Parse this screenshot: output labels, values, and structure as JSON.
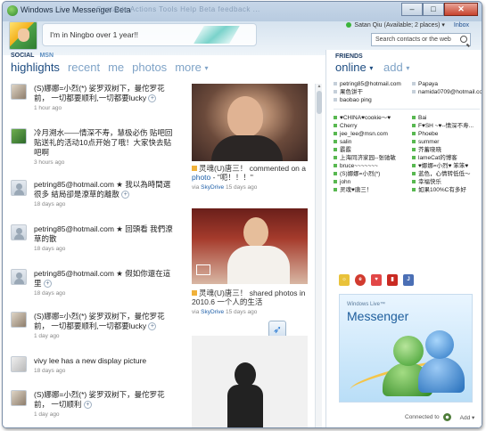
{
  "window": {
    "title": "Windows Live Messenger Beta",
    "faded_menu": "Contacts   Actions   Tools   Help   Beta feedback   ...",
    "minimize": "–",
    "maximize": "□",
    "close": "✕"
  },
  "header": {
    "status_message": "I'm in Ningbo over 1 year!!",
    "user_label": "Satan Qiu (Available; 2 places) ▾",
    "inbox_label": "Inbox",
    "search_placeholder": "Search contacts or the web"
  },
  "social_tabs": {
    "social": "SOCIAL",
    "msn": "MSN"
  },
  "nav": {
    "highlights": "highlights",
    "recent": "recent",
    "me": "me",
    "photos": "photos",
    "more": "more"
  },
  "feed": [
    {
      "text": "(S)娜娜=小烈(*) 娑罗双树下，曼佗罗花前， 一切都要顺利,一切都要lucky",
      "meta": "1 hour ago",
      "avatar": "photo"
    },
    {
      "text": "冷月溯水——情深不寿，慧极必伤 贴吧回贴送礼的活动10点开始了哦！大家快去贴吧啊",
      "meta": "3 hours ago",
      "avatar": "green"
    },
    {
      "text": "petring85@hotmail.com ★ 我以為時間選很多 結局卻是潦草的離散",
      "meta": "18 days ago",
      "avatar": "user"
    },
    {
      "text": "petring85@hotmail.com ★ 回頭看 我們潦草的散",
      "meta": "18 days ago",
      "avatar": "user"
    },
    {
      "text": "petring85@hotmail.com ★ 假如你還在這里",
      "meta": "18 days ago",
      "avatar": "user"
    },
    {
      "text": "(S)娜娜=小烈(*) 娑罗双树下，曼佗罗花前， 一切都要顺利,一切都要lucky",
      "meta": "1 day ago",
      "avatar": "photo"
    },
    {
      "text": "vivy lee has a new display picture",
      "meta": "18 days ago",
      "avatar": "vivy"
    },
    {
      "text": "(S)娜娜=小烈(*) 娑罗双树下，曼佗罗花前， 一切顺利",
      "meta": "1 day ago",
      "avatar": "photo"
    }
  ],
  "stories": [
    {
      "author": "灵魂(U)唐三！",
      "action": "commented on a",
      "link": "photo",
      "extra": "- \"呃！！！\"",
      "via_prefix": "via",
      "via": "SkyDrive",
      "time": "15 days ago"
    },
    {
      "author": "灵魂(U)唐三！",
      "action": "shared photos in 2010.6 一个人的生活",
      "via_prefix": "via",
      "via": "SkyDrive",
      "time": "15 days ago"
    }
  ],
  "friends": {
    "label": "FRIENDS",
    "online_tab": "online",
    "add_tab": "add",
    "group1_left": [
      "petring85@hotmail.com",
      "果色饼干",
      "baobao ping"
    ],
    "group1_right": [
      "Papaya",
      "namida0709@hotmail.com"
    ],
    "group2_left": [
      "♥CHINA♥cookie～♥",
      "Cherry",
      "jee_lee@msn.com",
      "salin",
      "霰霰",
      "上海同济家园--张驰敏",
      "bruce~~~~~~~",
      "(S)娜娜=小烈(*)",
      "john",
      "灵魂♥唐三！"
    ],
    "group2_right": [
      "Bai",
      "F♥SH ~♥--情深不寿...",
      "Phoebe",
      "summer",
      "芥蓄晓晓",
      "lameCat的博客",
      "♥娜娜=小烈♥ 笨笨♥",
      "蓝色，心情转低低～",
      "幸福快乐",
      "如果100%C有多好"
    ]
  },
  "ad": {
    "brand": "Windows Live™",
    "product": "Messenger"
  },
  "footer": {
    "connected": "Connected to",
    "add": "Add ▾"
  },
  "colors": {
    "accent": "#1c4b80",
    "link": "#1e5fa8",
    "online": "#58b850"
  }
}
